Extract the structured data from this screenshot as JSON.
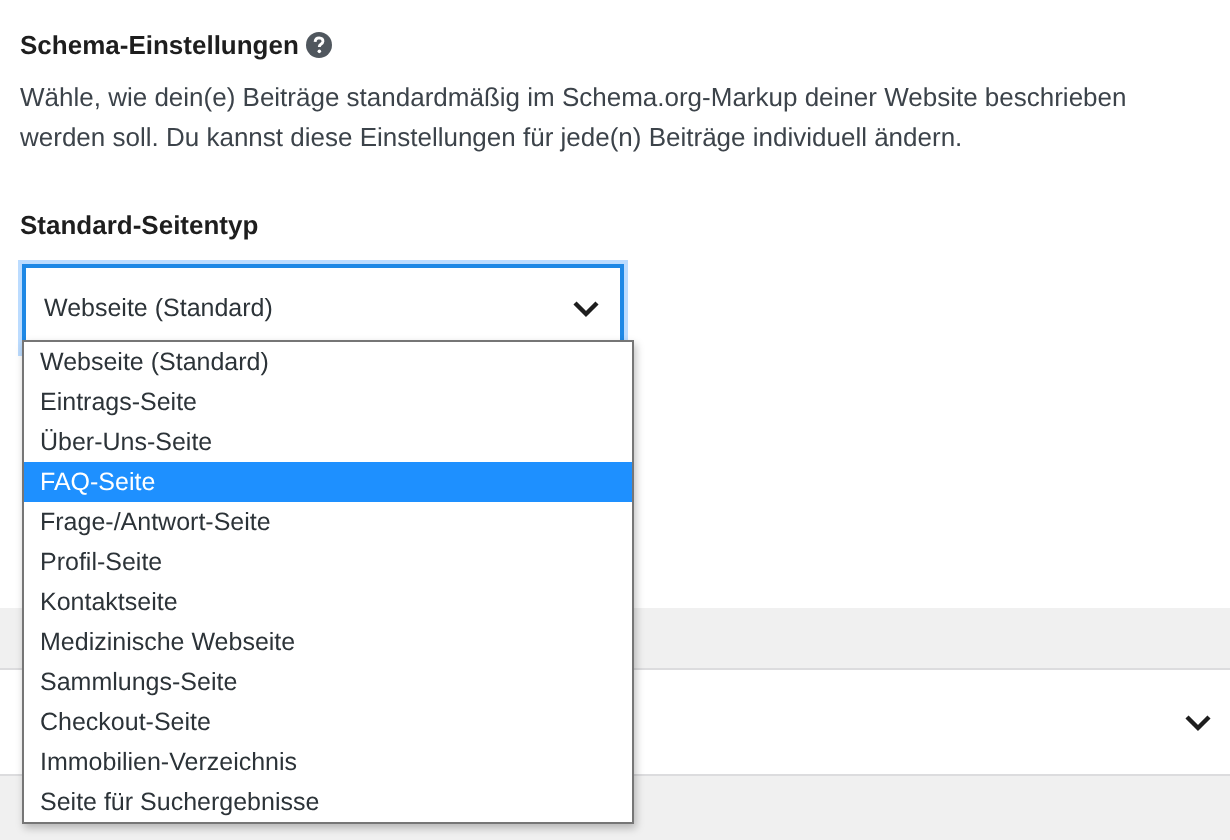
{
  "section": {
    "title": "Schema-Einstellungen",
    "description": "Wähle, wie dein(e) Beiträge standardmäßig im Schema.org-Markup deiner Website beschrieben werden soll. Du kannst diese Einstellungen für jede(n) Beiträge individuell ändern."
  },
  "field": {
    "label": "Standard-Seitentyp",
    "value": "Webseite (Standard)",
    "expanded": true
  },
  "options": [
    {
      "label": "Webseite (Standard)",
      "selected": false
    },
    {
      "label": "Eintrags-Seite",
      "selected": false
    },
    {
      "label": "Über-Uns-Seite",
      "selected": false
    },
    {
      "label": "FAQ-Seite",
      "selected": true
    },
    {
      "label": "Frage-/Antwort-Seite",
      "selected": false
    },
    {
      "label": "Profil-Seite",
      "selected": false
    },
    {
      "label": "Kontaktseite",
      "selected": false
    },
    {
      "label": "Medizinische Webseite",
      "selected": false
    },
    {
      "label": "Sammlungs-Seite",
      "selected": false
    },
    {
      "label": "Checkout-Seite",
      "selected": false
    },
    {
      "label": "Immobilien-Verzeichnis",
      "selected": false
    },
    {
      "label": "Seite für Suchergebnisse",
      "selected": false
    }
  ]
}
